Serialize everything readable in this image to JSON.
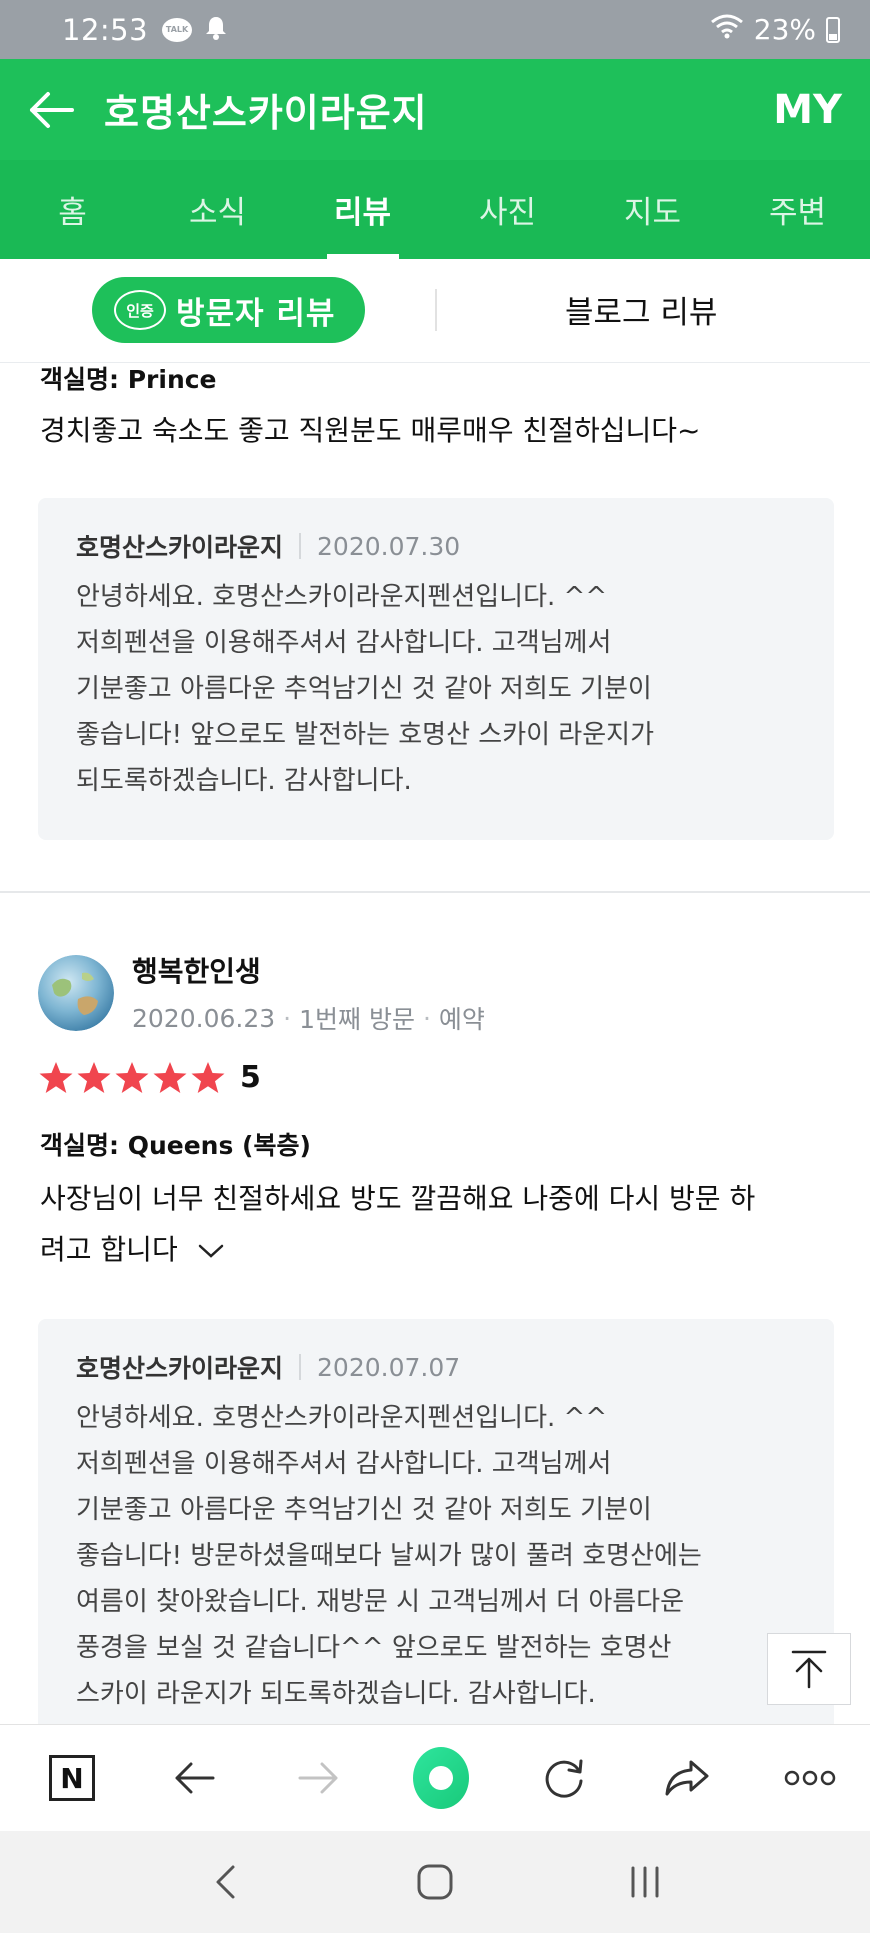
{
  "status_bar": {
    "time": "12:53",
    "talk_icon_text": "TALK",
    "battery": "23%"
  },
  "header": {
    "title": "호명산스카이라운지",
    "my_label": "MY"
  },
  "tabs": [
    {
      "label": "홈"
    },
    {
      "label": "소식"
    },
    {
      "label": "리뷰"
    },
    {
      "label": "사진"
    },
    {
      "label": "지도"
    },
    {
      "label": "주변"
    }
  ],
  "active_tab": "리뷰",
  "review_switch": {
    "cert_badge": "인증",
    "visitor_label": "방문자 리뷰",
    "blog_label": "블로그 리뷰"
  },
  "reviews": [
    {
      "room_label": "객실명:",
      "room_value": "Prince",
      "text": "경치좋고 숙소도 좋고 직원분도 매루매우 친절하십니다~",
      "reply": {
        "name": "호명산스카이라운지",
        "date": "2020.07.30",
        "body": "안녕하세요. 호명산스카이라운지펜션입니다. ^^\n저희펜션을 이용해주셔서 감사합니다. 고객님께서\n기분좋고 아름다운 추억남기신 것 같아 저희도 기분이\n좋습니다! 앞으로도 발전하는 호명산 스카이 라운지가\n되도록하겠습니다. 감사합니다."
      }
    },
    {
      "reviewer_name": "행복한인생",
      "date": "2020.06.23",
      "visit": "1번째 방문",
      "booking": "예약",
      "rating": "5",
      "rating_value": 5,
      "room_label": "객실명:",
      "room_value": "Queens (복층)",
      "text_line1": "사장님이 너무 친절하세요 방도 깔끔해요 나중에 다시 방문 하",
      "text_line2": "려고 합니다",
      "reply": {
        "name": "호명산스카이라운지",
        "date": "2020.07.07",
        "body": "안녕하세요. 호명산스카이라운지펜션입니다. ^^\n저희펜션을 이용해주셔서 감사합니다. 고객님께서\n기분좋고 아름다운 추억남기신 것 같아 저희도 기분이\n좋습니다! 방문하셨을때보다 날씨가 많이 풀려 호명산에는\n여름이 찾아왔습니다. 재방문 시 고객님께서 더 아름다운\n풍경을 보실 것 같습니다^^ 앞으로도 발전하는 호명산\n스카이 라운지가 되도록하겠습니다. 감사합니다."
      }
    }
  ],
  "browser_bar": {
    "home_logo": "N"
  },
  "colors": {
    "brand_green": "#1ec05a",
    "star_red": "#f0454e"
  }
}
